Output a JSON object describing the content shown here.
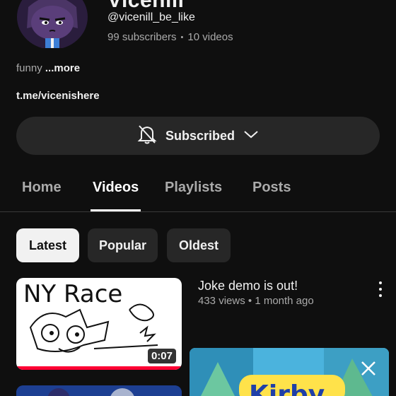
{
  "channel": {
    "title": "Vicenill",
    "handle": "@vicenill_be_like",
    "subscribers": "99 subscribers",
    "separator": "•",
    "videos": "10 videos",
    "description": "funny",
    "more_label": "...more",
    "link": "t.me/vicenishere"
  },
  "subscribe": {
    "label": "Subscribed",
    "bell_icon": "bell-off-icon",
    "chevron_icon": "chevron-down-icon"
  },
  "tabs": [
    {
      "label": "Home",
      "active": false
    },
    {
      "label": "Videos",
      "active": true
    },
    {
      "label": "Playlists",
      "active": false
    },
    {
      "label": "Posts",
      "active": false
    }
  ],
  "chips": [
    {
      "label": "Latest",
      "selected": true
    },
    {
      "label": "Popular",
      "selected": false
    },
    {
      "label": "Oldest",
      "selected": false
    }
  ],
  "videos": [
    {
      "title": "Joke demo is out!",
      "views": "433 views",
      "age": "1 month ago",
      "duration": "0:07",
      "thumb_text": "NY Race",
      "watched_fraction": 1.0
    }
  ],
  "ad": {
    "text": "Kirby",
    "close_icon": "close-icon"
  },
  "colors": {
    "background": "#0f0f0f",
    "button_bg": "#272727",
    "progress": "#ff0033",
    "secondary_text": "#aaaaaa"
  }
}
